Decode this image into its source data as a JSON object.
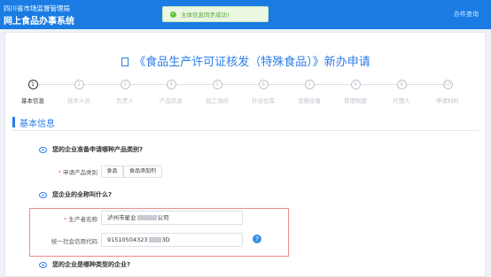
{
  "header": {
    "org": "四川省市场监督管理局",
    "system": "网上食品办事系统",
    "right_link": "办件查询"
  },
  "toast": {
    "text": "主体信息同步成功!"
  },
  "page_title": "《食品生产许可证核发（特殊食品）》新办申请",
  "steps": [
    {
      "num": "1",
      "label": "基本信息"
    },
    {
      "num": "2",
      "label": "技术人员"
    },
    {
      "num": "3",
      "label": "负责人"
    },
    {
      "num": "4",
      "label": "产品信息"
    },
    {
      "num": "5",
      "label": "加工场所"
    },
    {
      "num": "6",
      "label": "外设仓库"
    },
    {
      "num": "7",
      "label": "设施设备"
    },
    {
      "num": "8",
      "label": "管理制度"
    },
    {
      "num": "9",
      "label": "代理人"
    },
    {
      "num": "10",
      "label": "申请材料"
    }
  ],
  "section_title": "基本信息",
  "q1": {
    "text": "您的企业准备申请哪种产品类别?",
    "field_label": "申请产品类别",
    "options": [
      "食品",
      "食品添加剂"
    ]
  },
  "q2": {
    "text": "您企业的全称叫什么?",
    "producer_label": "生产者名称",
    "producer_value_prefix": "泸州市星业",
    "producer_value_suffix": "公司",
    "credit_label": "统一社会信用代码",
    "credit_value_prefix": "91510504323",
    "credit_value_suffix": "3D",
    "help": "?"
  },
  "q3": {
    "text": "您的企业是哪种类型的企业?"
  }
}
